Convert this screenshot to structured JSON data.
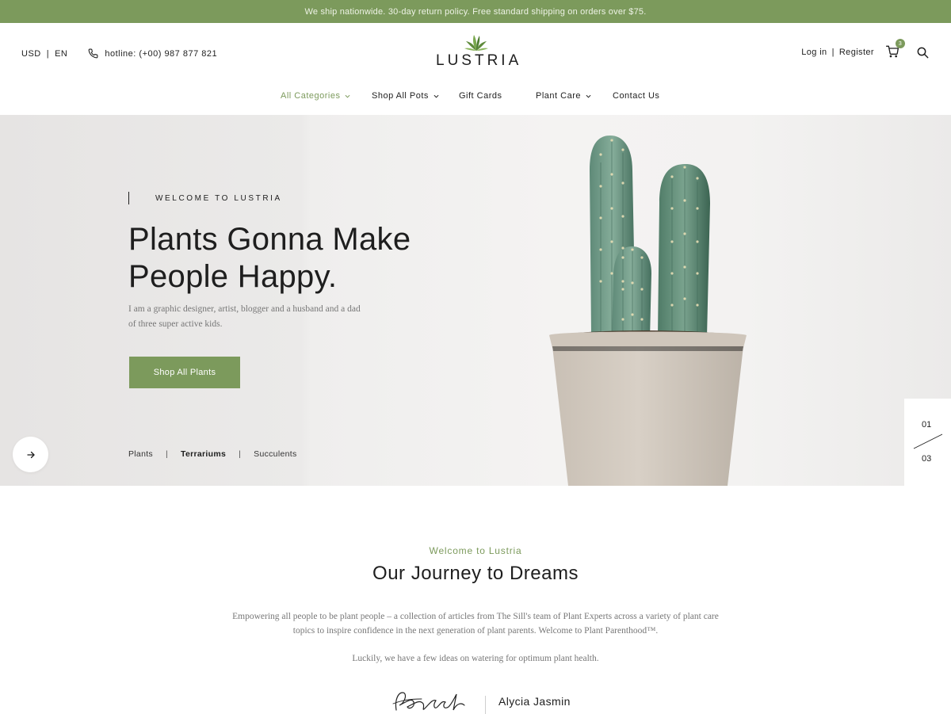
{
  "announcement": "We ship nationwide. 30-day return policy. Free standard shipping on orders over $75.",
  "header": {
    "currency": "USD",
    "language": "EN",
    "hotline": "hotline: (+00) 987 877 821",
    "logo_text": "LUSTRIA",
    "login": "Log in",
    "register": "Register",
    "cart_count": "3"
  },
  "nav": [
    {
      "label": "All Categories",
      "active": true,
      "dropdown": true
    },
    {
      "label": "Shop All Pots",
      "active": false,
      "dropdown": true
    },
    {
      "label": "Gift Cards",
      "active": false,
      "dropdown": false
    },
    {
      "label": "Plant Care",
      "active": false,
      "dropdown": true
    },
    {
      "label": "Contact Us",
      "active": false,
      "dropdown": false
    }
  ],
  "hero": {
    "eyebrow": "WELCOME TO LUSTRIA",
    "title_line1": "Plants Gonna Make",
    "title_line2": "People Happy.",
    "description": "I am a graphic designer, artist, blogger and a husband and a dad of three super active kids.",
    "cta": "Shop All Plants",
    "categories": [
      "Plants",
      "Terrariums",
      "Succulents"
    ],
    "current_category": "Terrariums",
    "slide_current": "01",
    "slide_total": "03"
  },
  "about": {
    "kicker": "Welcome to Lustria",
    "title": "Our Journey to Dreams",
    "paragraph1": "Empowering all people to be plant people – a collection of articles from The Sill's team of Plant Experts across a variety of plant care topics to inspire confidence in the next generation of plant parents. Welcome to Plant Parenthood™.",
    "paragraph2": "Luckily, we have a few ideas on watering for optimum plant health.",
    "author": "Alycia Jasmin"
  },
  "colors": {
    "accent": "#7c9a5c",
    "text": "#1e1e1e",
    "muted": "#777777"
  },
  "icons": [
    "phone-icon",
    "leaf-logo-icon",
    "cart-icon",
    "search-icon",
    "chevron-down-icon",
    "arrow-right-icon"
  ]
}
